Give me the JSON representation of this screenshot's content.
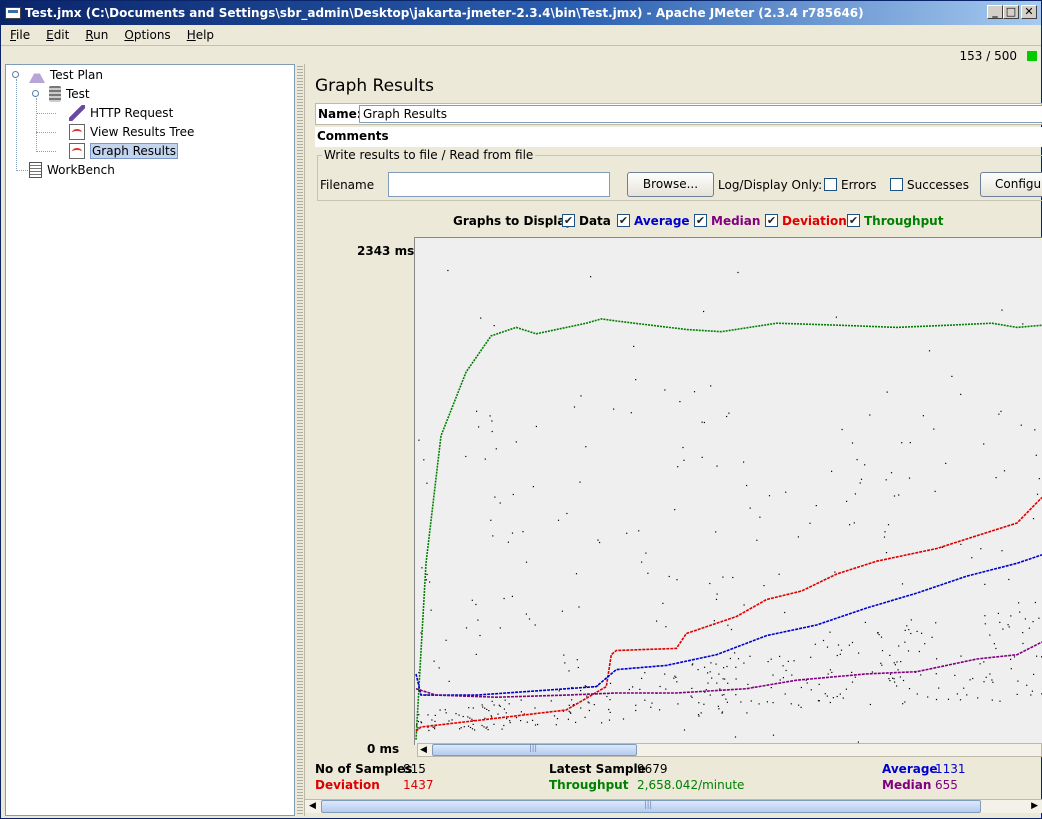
{
  "window": {
    "title": "Test.jmx (C:\\Documents and Settings\\sbr_admin\\Desktop\\jakarta-jmeter-2.3.4\\bin\\Test.jmx) - Apache JMeter (2.3.4 r785646)"
  },
  "menu": [
    "File",
    "Edit",
    "Run",
    "Options",
    "Help"
  ],
  "status": {
    "counter": "153 / 500",
    "indicator_color": "#00cc00"
  },
  "tree": [
    {
      "label": "Test Plan",
      "icon": "test-plan-flask-icon"
    },
    {
      "label": "Test",
      "icon": "thread-group-icon"
    },
    {
      "label": "HTTP Request",
      "icon": "http-sampler-dropper-icon"
    },
    {
      "label": "View Results Tree",
      "icon": "listener-chart-icon"
    },
    {
      "label": "Graph Results",
      "icon": "listener-chart-icon",
      "selected": true
    },
    {
      "label": "WorkBench",
      "icon": "workbench-icon"
    }
  ],
  "panel": {
    "title": "Graph Results",
    "name_label": "Name:",
    "name_value": "Graph Results",
    "comments_label": "Comments:",
    "file_group_label": "Write results to file / Read from file",
    "filename_label": "Filename",
    "browse_button": "Browse...",
    "log_display_label": "Log/Display Only:",
    "errors_label": "Errors",
    "successes_label": "Successes",
    "configure_button": "Configu",
    "graphs_to_display_label": "Graphs to Display",
    "graph_options": [
      {
        "label": "Data",
        "checked": true,
        "color": "#000000"
      },
      {
        "label": "Average",
        "checked": true,
        "color": "#0000cc"
      },
      {
        "label": "Median",
        "checked": true,
        "color": "#800080"
      },
      {
        "label": "Deviation",
        "checked": true,
        "color": "#dd0000"
      },
      {
        "label": "Throughput",
        "checked": true,
        "color": "#008000"
      }
    ],
    "y_max_label": "2343 ms",
    "y_min_label": "0 ms"
  },
  "stats": {
    "samples_label": "No of Samples",
    "samples_value": "815",
    "latest_label": "Latest Sample",
    "latest_value": "9679",
    "average_label": "Average",
    "average_value": "1131",
    "deviation_label": "Deviation",
    "deviation_value": "1437",
    "throughput_label": "Throughput",
    "throughput_value": "2,658.042/minute",
    "median_label": "Median",
    "median_value": "655"
  },
  "chart_data": {
    "type": "line",
    "ylim": [
      0,
      2343
    ],
    "yunit": "ms",
    "series": [
      {
        "name": "Throughput",
        "color": "#008000",
        "points": [
          [
            0,
            20
          ],
          [
            10,
            850
          ],
          [
            25,
            1450
          ],
          [
            50,
            1750
          ],
          [
            75,
            1920
          ],
          [
            100,
            1960
          ],
          [
            120,
            1930
          ],
          [
            170,
            1980
          ],
          [
            185,
            2000
          ],
          [
            200,
            1990
          ],
          [
            270,
            1950
          ],
          [
            305,
            1940
          ],
          [
            360,
            1980
          ],
          [
            425,
            1970
          ],
          [
            480,
            1960
          ],
          [
            530,
            1970
          ],
          [
            575,
            1980
          ],
          [
            600,
            1960
          ],
          [
            625,
            1970
          ]
        ]
      },
      {
        "name": "Deviation",
        "color": "#dd0000",
        "points": [
          [
            0,
            60
          ],
          [
            5,
            80
          ],
          [
            60,
            110
          ],
          [
            150,
            160
          ],
          [
            190,
            270
          ],
          [
            195,
            420
          ],
          [
            200,
            440
          ],
          [
            260,
            450
          ],
          [
            270,
            520
          ],
          [
            320,
            600
          ],
          [
            350,
            680
          ],
          [
            385,
            720
          ],
          [
            420,
            800
          ],
          [
            460,
            860
          ],
          [
            520,
            920
          ],
          [
            560,
            980
          ],
          [
            600,
            1040
          ],
          [
            625,
            1160
          ]
        ]
      },
      {
        "name": "Average",
        "color": "#0000cc",
        "points": [
          [
            0,
            330
          ],
          [
            5,
            230
          ],
          [
            60,
            230
          ],
          [
            120,
            250
          ],
          [
            180,
            270
          ],
          [
            200,
            350
          ],
          [
            250,
            370
          ],
          [
            300,
            420
          ],
          [
            350,
            510
          ],
          [
            400,
            560
          ],
          [
            450,
            640
          ],
          [
            500,
            710
          ],
          [
            550,
            790
          ],
          [
            600,
            850
          ],
          [
            625,
            890
          ]
        ]
      },
      {
        "name": "Median",
        "color": "#800080",
        "points": [
          [
            0,
            260
          ],
          [
            20,
            230
          ],
          [
            80,
            220
          ],
          [
            150,
            230
          ],
          [
            200,
            240
          ],
          [
            260,
            240
          ],
          [
            330,
            260
          ],
          [
            380,
            300
          ],
          [
            450,
            330
          ],
          [
            500,
            340
          ],
          [
            560,
            400
          ],
          [
            600,
            420
          ],
          [
            625,
            480
          ]
        ]
      }
    ]
  }
}
